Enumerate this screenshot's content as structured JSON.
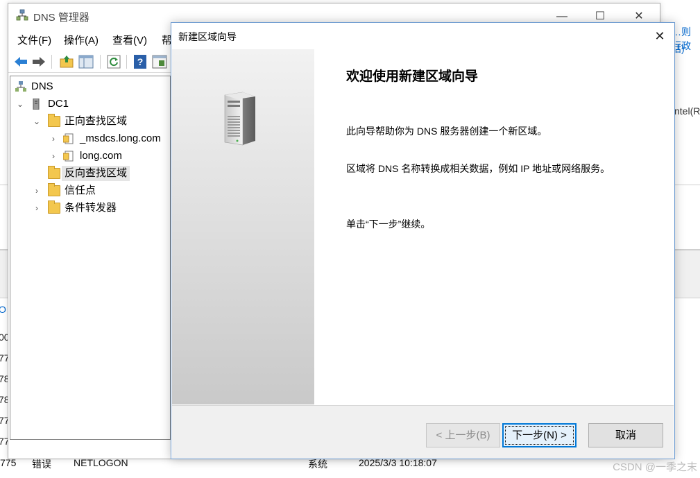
{
  "background": {
    "right_link_1": "…则行政",
    "right_link_2": "括)",
    "right_text_3": "ntel(R",
    "row_stubs": [
      "O",
      "00",
      "77",
      "78",
      "78",
      "77",
      "77"
    ],
    "bottom_row": {
      "id": "775",
      "level": "错误",
      "source": "NETLOGON",
      "category": "系统",
      "time": "2025/3/3 10:18:07"
    }
  },
  "dns_manager": {
    "title": "DNS 管理器",
    "menu": [
      "文件(F)",
      "操作(A)",
      "查看(V)",
      "帮"
    ],
    "toolbar_icons": [
      "back-icon",
      "forward-icon",
      "up-folder-icon",
      "show-hide-tree-icon",
      "refresh-icon",
      "help-icon",
      "properties-icon"
    ],
    "tree": {
      "root": "DNS",
      "server": "DC1",
      "forward_zones": "正向查找区域",
      "zone_1": "_msdcs.long.com",
      "zone_2": "long.com",
      "reverse_zones": "反向查找区域",
      "trust_points": "信任点",
      "conditional_forwarders": "条件转发器"
    }
  },
  "wizard": {
    "title": "新建区域向导",
    "heading": "欢迎使用新建区域向导",
    "paragraph_1": "此向导帮助你为 DNS 服务器创建一个新区域。",
    "paragraph_2": "区域将 DNS 名称转换成相关数据，例如 IP 地址或网络服务。",
    "paragraph_3": "单击“下一步”继续。",
    "buttons": {
      "back": "< 上一步(B)",
      "next": "下一步(N) >",
      "cancel": "取消"
    }
  },
  "watermark": "CSDN @一季之末",
  "colors": {
    "accent": "#0078d7",
    "link": "#0066cc",
    "folder": "#f3c74e"
  }
}
